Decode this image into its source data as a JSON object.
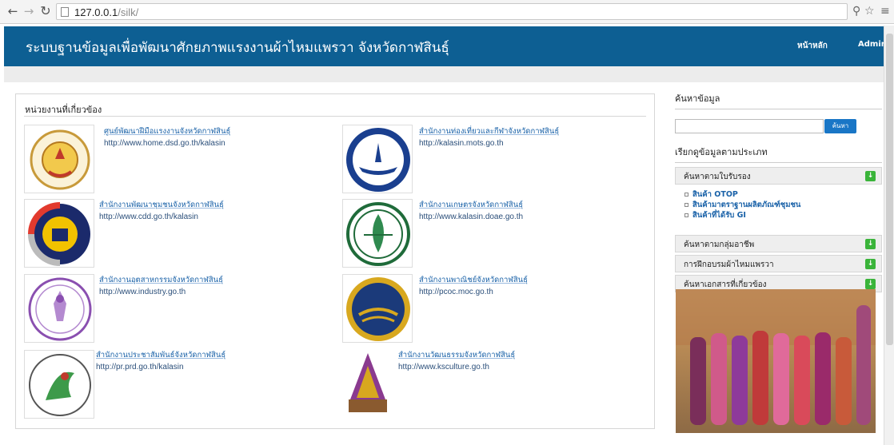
{
  "browser": {
    "url_host": "127.0.0.1",
    "url_path": "/silk/"
  },
  "header": {
    "title": "ระบบฐานข้อมูลเพื่อพัฒนาศักยภาพแรงงานผ้าไหมแพรวา จังหวัดกาฬสินธุ์",
    "nav_home": "หน้าหลัก",
    "nav_admin": "Admin",
    "color": "#0d5f93"
  },
  "main": {
    "heading": "หน่วยงานที่เกี่ยวข้อง",
    "cards": [
      {
        "name": "ศูนย์พัฒนาฝีมือแรงงานจังหวัดกาฬสินธุ์",
        "url": "http://www.home.dsd.go.th/kalasin",
        "logo": "dsd-logo"
      },
      {
        "name": "สำนักงานท่องเที่ยวและกีฬาจังหวัดกาฬสินธุ์",
        "url": "http://kalasin.mots.go.th",
        "logo": "mots-logo"
      },
      {
        "name": "สำนักงานพัฒนาชุมชนจังหวัดกาฬสินธุ์",
        "url": "http://www.cdd.go.th/kalasin",
        "logo": "cdd-logo"
      },
      {
        "name": "สำนักงานเกษตรจังหวัดกาฬสินธุ์",
        "url": "http://www.kalasin.doae.go.th",
        "logo": "doae-logo"
      },
      {
        "name": "สำนักงานอุตสาหกรรมจังหวัดกาฬสินธุ์",
        "url": "http://www.industry.go.th",
        "logo": "industry-logo"
      },
      {
        "name": "สำนักงานพาณิชย์จังหวัดกาฬสินธุ์",
        "url": "http://pcoc.moc.go.th",
        "logo": "moc-logo"
      },
      {
        "name": "สำนักงานประชาสัมพันธ์จังหวัดกาฬสินธุ์",
        "url": "http://pr.prd.go.th/kalasin",
        "logo": "prd-logo"
      },
      {
        "name": "สำนักงานวัฒนธรรมจังหวัดกาฬสินธุ์",
        "url": "http://www.ksculture.go.th",
        "logo": "culture-logo"
      }
    ]
  },
  "sidebar": {
    "search_heading": "ค้นหาข้อมูล",
    "search_value": "",
    "search_button": "ค้นหา",
    "category_heading": "เรียกดูข้อมูลตามประเภท",
    "accordions": [
      {
        "label": "ค้นหาตามใบรับรอง",
        "open": true,
        "items": [
          "สินค้า OTOP",
          "สินค้ามาตราฐานผลิตภัณฑ์ชุมชน",
          "สินค้าที่ได้รับ GI"
        ]
      },
      {
        "label": "ค้นหาตามกลุ่มอาชีพ",
        "open": false
      },
      {
        "label": "การฝึกอบรมผ้าไหมแพรวา",
        "open": false
      },
      {
        "label": "ค้นหาเอกสารที่เกี่ยวข้อง",
        "open": false
      }
    ],
    "accent_green": "#3ab43a",
    "button_blue": "#1976c6"
  }
}
